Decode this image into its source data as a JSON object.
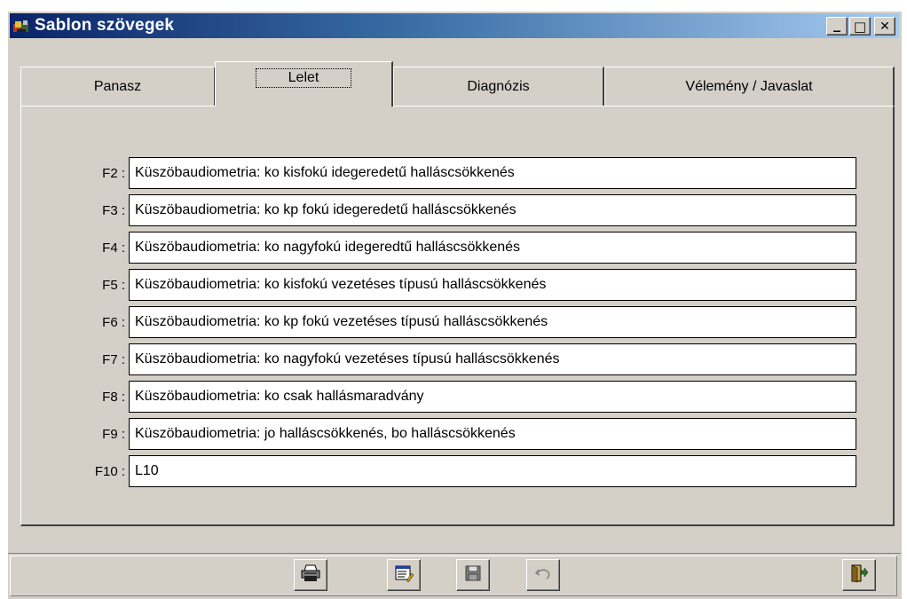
{
  "window": {
    "title": "Sablon szövegek",
    "minimize_label": "_",
    "maximize_label": "□",
    "close_label": "✕"
  },
  "tabs": [
    {
      "label": "Panasz",
      "active": false
    },
    {
      "label": "Lelet",
      "active": true
    },
    {
      "label": "Diagnózis",
      "active": false
    },
    {
      "label": "Vélemény / Javaslat",
      "active": false
    }
  ],
  "templates": [
    {
      "key": "F2 :",
      "text": "Küszöbaudiometria: ko kisfokú idegeredetű halláscsökkenés"
    },
    {
      "key": "F3 :",
      "text": "Küszöbaudiometria: ko kp fokú idegeredetű halláscsökkenés"
    },
    {
      "key": "F4 :",
      "text": "Küszöbaudiometria: ko nagyfokú idegeredtű halláscsökkenés"
    },
    {
      "key": "F5 :",
      "text": "Küszöbaudiometria: ko kisfokú vezetéses típusú halláscsökkenés"
    },
    {
      "key": "F6 :",
      "text": "Küszöbaudiometria: ko kp fokú vezetéses típusú halláscsökkenés"
    },
    {
      "key": "F7 :",
      "text": "Küszöbaudiometria: ko nagyfokú vezetéses típusú halláscsökkenés"
    },
    {
      "key": "F8 :",
      "text": "Küszöbaudiometria: ko csak hallásmaradvány"
    },
    {
      "key": "F9 :",
      "text": "Küszöbaudiometria: jo halláscsökkenés, bo halláscsökkenés"
    },
    {
      "key": "F10 :",
      "text": "L10"
    }
  ],
  "toolbar": {
    "buttons": [
      {
        "icon": "print-icon"
      },
      {
        "icon": "edit-icon"
      },
      {
        "icon": "save-icon"
      },
      {
        "icon": "undo-icon"
      },
      {
        "icon": "exit-icon"
      }
    ]
  },
  "colors": {
    "titlebar_start": "#0a246a",
    "titlebar_end": "#a6caf0",
    "face": "#d4d0c8"
  }
}
